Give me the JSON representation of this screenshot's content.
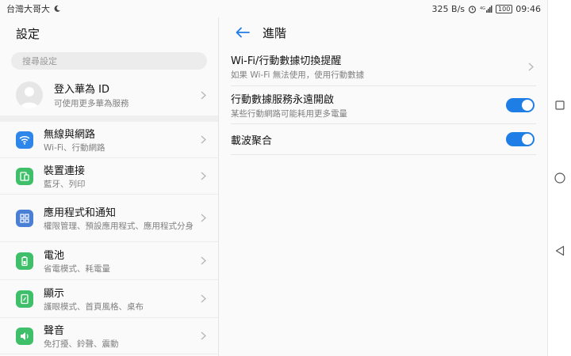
{
  "status_bar": {
    "carrier": "台灣大哥大",
    "net_speed": "325 B/s",
    "battery": "100",
    "time": "09:46"
  },
  "left": {
    "title": "設定",
    "search_placeholder": "搜尋設定",
    "account": {
      "title": "登入華為 ID",
      "subtitle": "可使用更多華為服務"
    },
    "items": [
      {
        "title": "無線與網路",
        "subtitle": "Wi-Fi、行動網路",
        "icon": "wifi-icon",
        "color": "#2f86ea"
      },
      {
        "title": "裝置連接",
        "subtitle": "藍牙、列印",
        "icon": "device-connection-icon",
        "color": "#3fbf6a"
      },
      {
        "title": "應用程式和通知",
        "subtitle": "權限管理、預設應用程式、應用程式分身",
        "icon": "apps-icon",
        "color": "#4a7fd6"
      },
      {
        "title": "電池",
        "subtitle": "省電模式、耗電量",
        "icon": "battery-icon",
        "color": "#3fbf6a"
      },
      {
        "title": "顯示",
        "subtitle": "護眼模式、首頁風格、桌布",
        "icon": "display-icon",
        "color": "#3fbf6a"
      },
      {
        "title": "聲音",
        "subtitle": "免打擾、鈴聲、震動",
        "icon": "sound-icon",
        "color": "#3fbf6a"
      }
    ]
  },
  "right": {
    "title": "進階",
    "settings": [
      {
        "title": "Wi-Fi/行動數據切換提醒",
        "subtitle": "如果 Wi-Fi 無法使用，使用行動數據",
        "control": "chevron"
      },
      {
        "title": "行動數據服務永遠開啟",
        "subtitle": "某些行動網路可能耗用更多電量",
        "control": "toggle",
        "on": true
      },
      {
        "title": "載波聚合",
        "subtitle": "",
        "control": "toggle",
        "on": true
      }
    ]
  },
  "colors": {
    "accent": "#1f7de6"
  }
}
